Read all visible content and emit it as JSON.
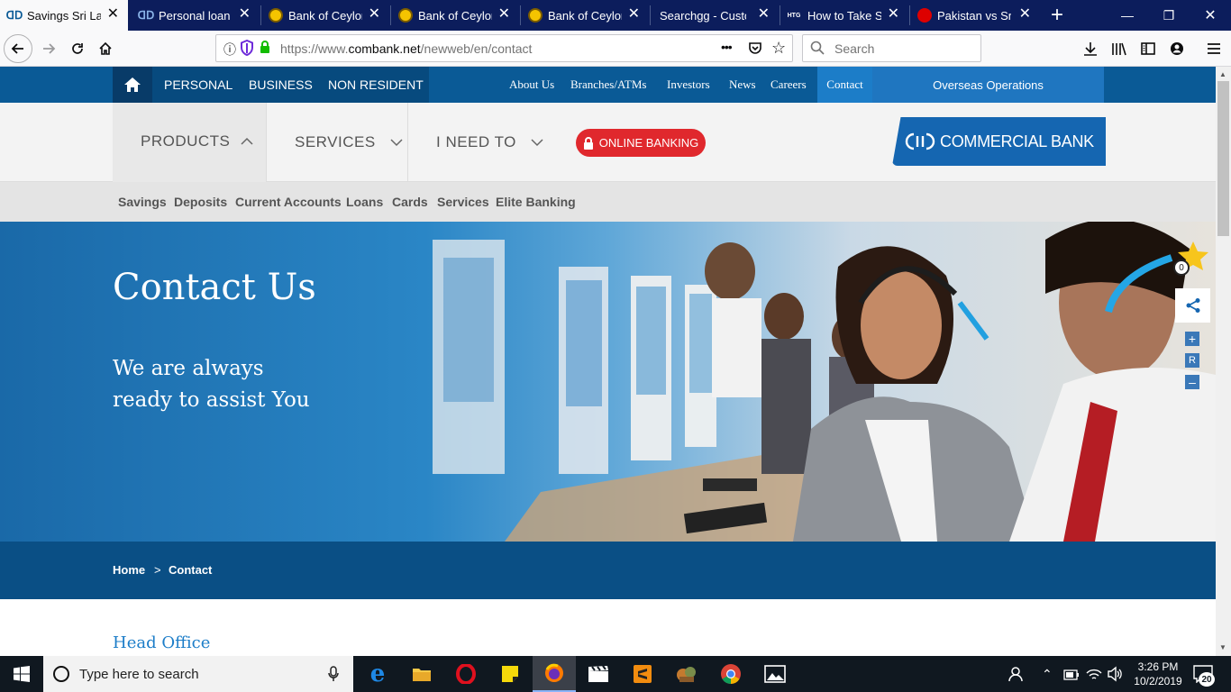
{
  "browser": {
    "tabs": [
      {
        "label": "Savings Sri Lanka",
        "favicon": "combank-icon",
        "active": true
      },
      {
        "label": "Personal loan | ",
        "favicon": "combank-icon",
        "active": false
      },
      {
        "label": "Bank of Ceylon",
        "favicon": "boc-icon",
        "active": false
      },
      {
        "label": "Bank of Ceylon",
        "favicon": "boc-icon",
        "active": false
      },
      {
        "label": "Bank of Ceylon",
        "favicon": "boc-icon",
        "active": false
      },
      {
        "label": "Searchgg - Custom",
        "favicon": "none",
        "active": false
      },
      {
        "label": "How to Take Sc",
        "favicon": "htg-icon",
        "active": false
      },
      {
        "label": "Pakistan vs Sri L",
        "favicon": "pk-icon",
        "active": false
      }
    ],
    "htg_favicon_text": "HTG",
    "url_prefix": "https://www.",
    "url_domain": "combank.net",
    "url_path": "/newweb/en/contact",
    "search_placeholder": "Search",
    "url_more": "•••"
  },
  "site": {
    "top_nav_left": [
      "PERSONAL",
      "BUSINESS",
      "NON RESIDENT"
    ],
    "top_nav_right": [
      "About Us",
      "Branches/ATMs",
      "Investors",
      "News",
      "Careers",
      "Contact"
    ],
    "overseas": "Overseas Operations",
    "main_nav": [
      "PRODUCTS",
      "SERVICES",
      "I NEED TO"
    ],
    "online_banking": "ONLINE BANKING",
    "logo_text": "COMMERCIAL BANK",
    "sub_nav": [
      "Savings",
      "Deposits",
      "Current Accounts",
      "Loans",
      "Cards",
      "Services",
      "Elite Banking"
    ],
    "hero_title": "Contact Us",
    "hero_subtitle_line1": "We are always",
    "hero_subtitle_line2": "ready to assist You",
    "favorites_count": "0",
    "zoom_controls": [
      "+",
      "R",
      "–"
    ],
    "breadcrumb_home": "Home",
    "breadcrumb_sep": ">",
    "breadcrumb_current": "Contact",
    "section_heading": "Head Office"
  },
  "taskbar": {
    "search_placeholder": "Type here to search",
    "time": "3:26 PM",
    "date": "10/2/2019",
    "notification_count": "20"
  },
  "colors": {
    "brand_blue": "#0a5a96",
    "dark_blue": "#0a4f85",
    "online_banking_red": "#e0282d",
    "browser_tab_bar": "#0c1d5c"
  }
}
